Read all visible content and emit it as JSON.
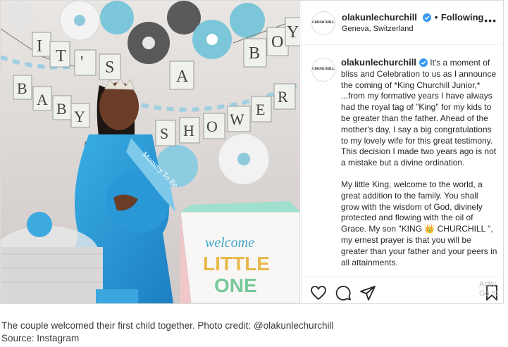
{
  "post": {
    "username": "olakunlechurchill",
    "follow_state": "Following",
    "follow_dot": "•",
    "location": "Geneva, Switzerland",
    "avatar_text": "CHURCHILL",
    "more_icon": "•••",
    "caption_p1": "It's a moment of bliss and Celebration to us as I announce the coming of *King Churchill Junior,* ...from my formative years I have always had the royal tag of \"King\" for my kids to be greater than the father. Ahead of the mother's day, I say a big congratulations to my lovely wife for this great testimony. This decision I made two years ago is not a mistake but a divine ordination.",
    "caption_p2_before": "My little King, welcome to the world, a great addition to the family. You shall grow with the wisdom of God, divinely protected and flowing with the oil of Grace. My son \"KING",
    "crown_emoji": "👑",
    "caption_p2_after": "CHURCHILL \", my ernest prayer is that you will be greater than your father and your peers in all attainments.",
    "watermark": "Activ\nGo to"
  },
  "photo": {
    "banner_top": [
      "I",
      "T",
      "'",
      "S",
      "A",
      "B",
      "O",
      "Y"
    ],
    "banner_left": [
      "B",
      "A",
      "B",
      "Y"
    ],
    "banner_right": [
      "S",
      "H",
      "O",
      "W",
      "E",
      "R"
    ],
    "sash_text": "Mommy To Be",
    "bag_text_1": "welcome",
    "bag_text_2": "LITTLE",
    "bag_text_3": "ONE"
  },
  "figure": {
    "caption_line": "The couple welcomed their first child together. Photo credit: @olakunlechurchill",
    "source_line": "Source: Instagram"
  },
  "colors": {
    "accent_blue": "#1aa3e0",
    "verified_blue": "#3897f0",
    "dress_blue": "#2f9ed8"
  },
  "icons": [
    "heart-icon",
    "comment-icon",
    "share-icon",
    "bookmark-icon",
    "verified-icon",
    "crown-icon"
  ]
}
